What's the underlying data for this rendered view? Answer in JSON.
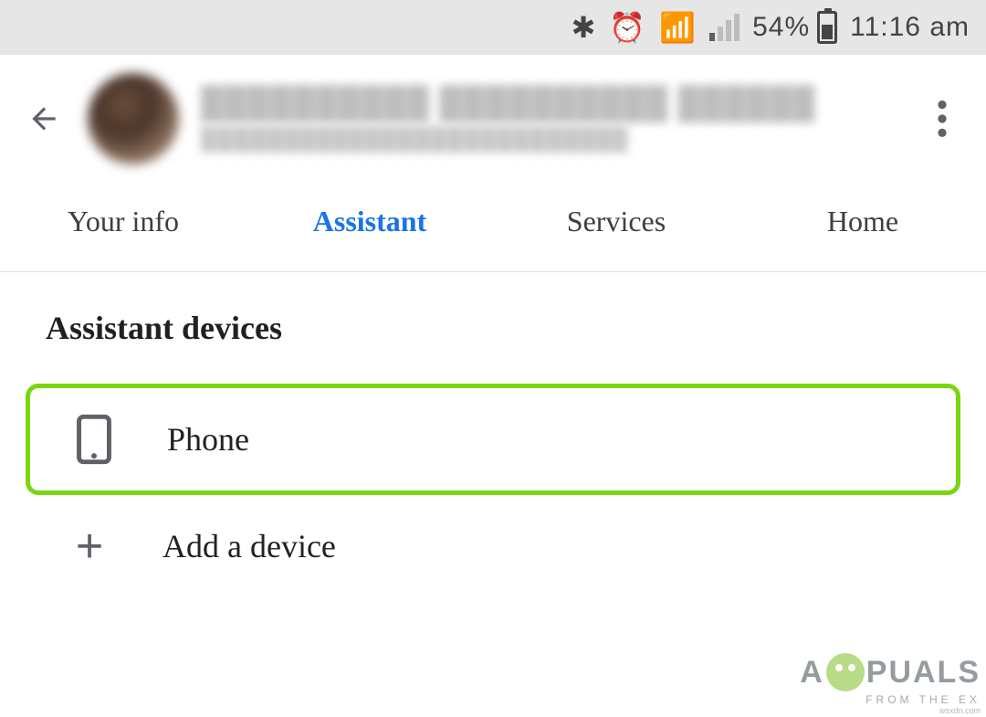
{
  "status_bar": {
    "battery_pct": "54%",
    "time": "11:16 am"
  },
  "profile": {
    "name_placeholder": "██████████ ██████████ ██████",
    "email_placeholder": "██████████████████████████"
  },
  "tabs": [
    {
      "label": "Your info",
      "active": false
    },
    {
      "label": "Assistant",
      "active": true
    },
    {
      "label": "Services",
      "active": false
    },
    {
      "label": "Home",
      "active": false
    }
  ],
  "section": {
    "title": "Assistant devices",
    "items": [
      {
        "label": "Phone",
        "icon": "phone",
        "highlighted": true
      },
      {
        "label": "Add a device",
        "icon": "plus",
        "highlighted": false
      }
    ]
  },
  "watermark": {
    "main_before": "A",
    "main_after": "PUALS",
    "sub": "FROM  THE  EX",
    "source": "wsxdn.com"
  }
}
